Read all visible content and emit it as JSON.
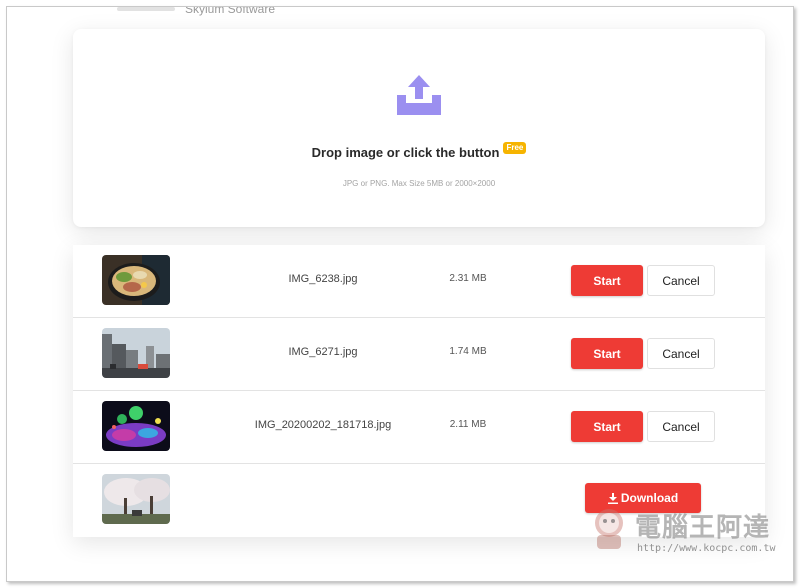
{
  "header": {
    "brand": "Skylum Software"
  },
  "upload": {
    "title": "Drop image or click the button",
    "badge": "Free",
    "hint": "JPG or PNG. Max Size 5MB or 2000×2000",
    "icon": "upload-tray-icon",
    "accent": "#9b8ff0"
  },
  "files": [
    {
      "name": "IMG_6238.jpg",
      "size": "2.31 MB",
      "thumb": "ramen-bowl-photo",
      "action": "Start",
      "cancel": "Cancel"
    },
    {
      "name": "IMG_6271.jpg",
      "size": "1.74 MB",
      "thumb": "city-street-photo",
      "action": "Start",
      "cancel": "Cancel"
    },
    {
      "name": "IMG_20200202_181718.jpg",
      "size": "2.11 MB",
      "thumb": "illuminated-night-park-photo",
      "action": "Start",
      "cancel": "Cancel"
    },
    {
      "name": "",
      "size": "",
      "thumb": "cherry-blossom-photo",
      "download": "Download"
    }
  ],
  "watermark": {
    "title": "電腦王阿達",
    "url": "http://www.kocpc.com.tw"
  },
  "colors": {
    "primary": "#ee3b35",
    "badge": "#f6b400"
  }
}
